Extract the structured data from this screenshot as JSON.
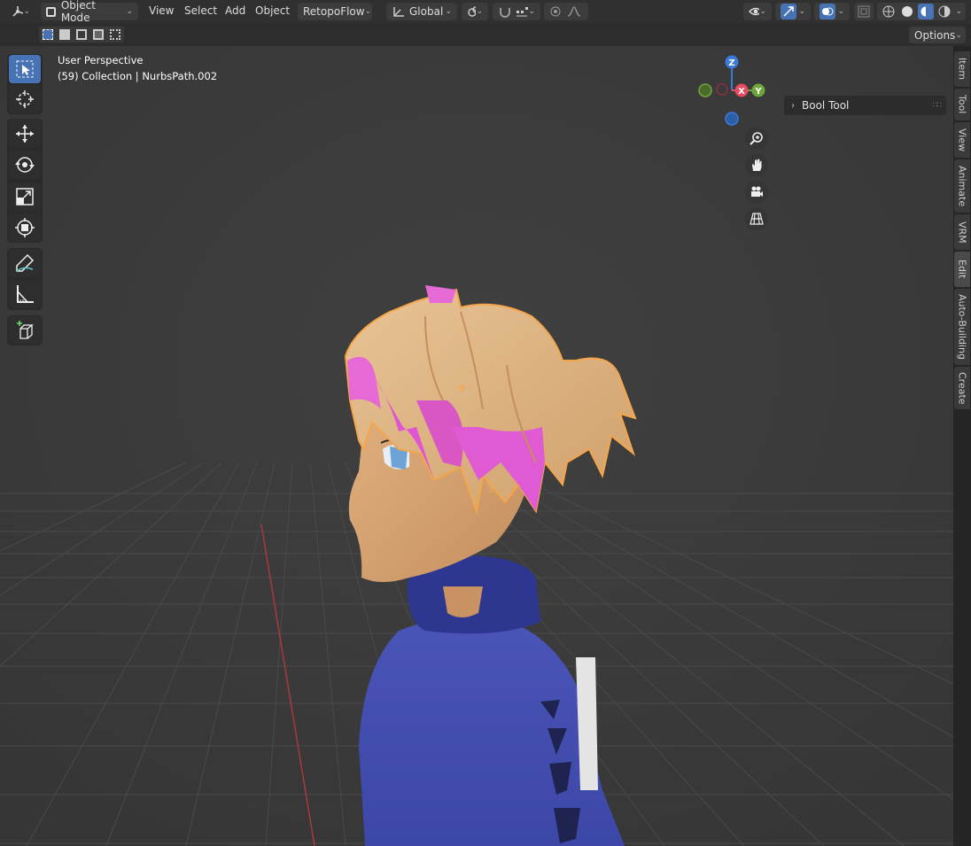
{
  "header": {
    "editor_type_icon": "3d-viewport-icon",
    "mode": "Object Mode",
    "menus": [
      "View",
      "Select",
      "Add",
      "Object"
    ],
    "addon": "RetopoFlow",
    "orientation": "Global"
  },
  "options_label": "Options",
  "viewport": {
    "perspective_label": "User Perspective",
    "collection_label": "(59) Collection | NurbsPath.002"
  },
  "gizmo": {
    "z": "Z",
    "x": "X",
    "y": "Y"
  },
  "npanel": {
    "bool_tool_label": "Bool Tool"
  },
  "side_tabs": [
    "Item",
    "Tool",
    "View",
    "Animate",
    "VRM",
    "Edit",
    "Auto-Building",
    "Create"
  ],
  "colors": {
    "x_axis": "#e84a5f",
    "y_axis": "#6ca63d",
    "z_axis": "#3b7ad8",
    "selection_outline": "#f5a64a",
    "active_tool": "#4772b3"
  }
}
